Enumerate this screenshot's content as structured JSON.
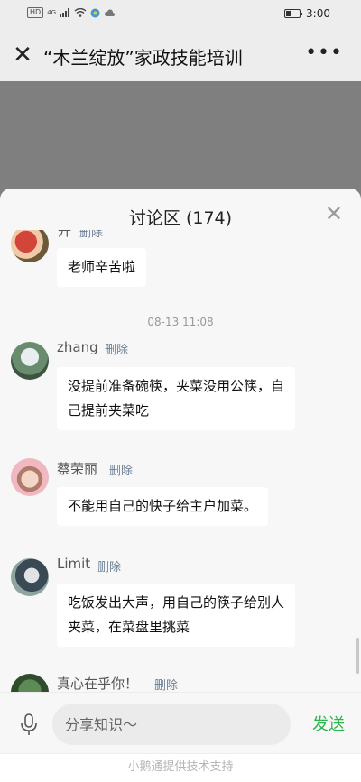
{
  "status_bar": {
    "network": "HD",
    "signal": "4G",
    "time": "3:00"
  },
  "nav": {
    "title": "“木兰绽放”家政技能培训",
    "close_icon": "close-icon",
    "more_icon": "more-icon"
  },
  "sheet": {
    "title": "讨论区 (174)",
    "messages": [
      {
        "user": "开",
        "delete": "删除",
        "text": "老师辛苦啦"
      },
      {
        "timestamp": "08-13 11:08"
      },
      {
        "user": "zhang",
        "delete": "删除",
        "text_lines": [
          "没提前准备碗筷，夹菜没用公筷，自",
          "己提前夹菜吃"
        ]
      },
      {
        "user": "蔡荣丽",
        "delete": "删除",
        "text": "不能用自己的快子给主户加菜。"
      },
      {
        "user": "Limit",
        "delete": "删除",
        "text_lines": [
          "吃饭发出大声，用自己的筷子给别人",
          "夹菜，在菜盘里挑菜"
        ]
      },
      {
        "user": "真心在乎你！",
        "delete": "删除"
      }
    ]
  },
  "input": {
    "placeholder": "分享知识～",
    "send": "发送"
  },
  "footer": {
    "text": "小鹅通提供技术支持"
  },
  "colors": {
    "accent_green": "#2bb34e",
    "delete_link": "#6a7f95",
    "overlay": "#7f7f7f"
  }
}
